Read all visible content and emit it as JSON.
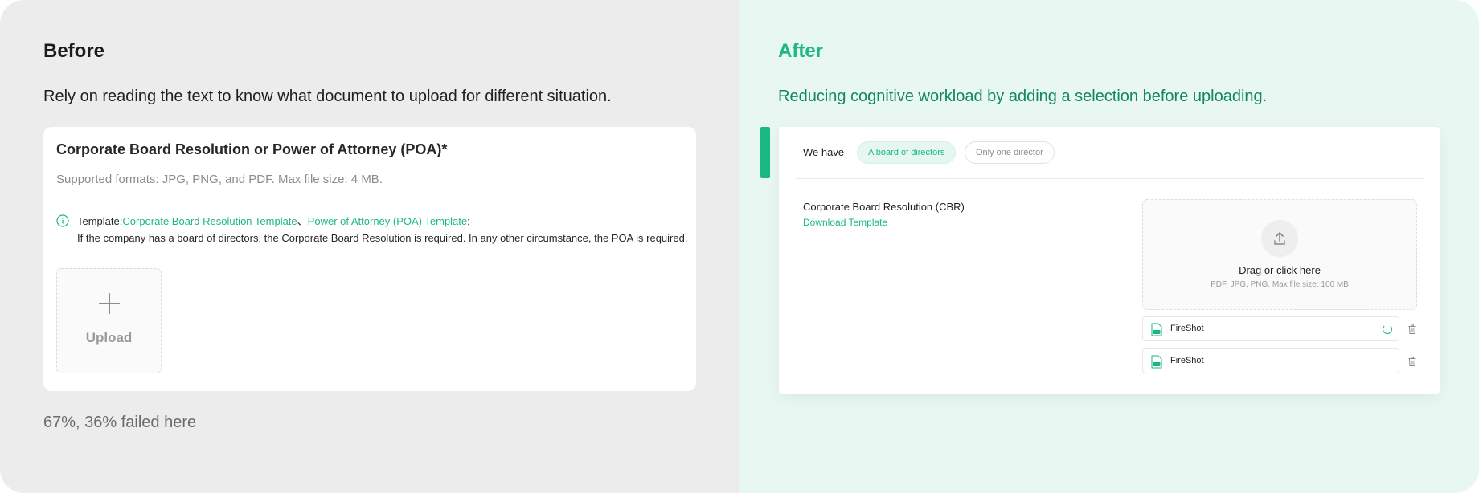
{
  "before": {
    "heading": "Before",
    "description": "Rely on reading the text to know what document to upload for different situation.",
    "card": {
      "title": "Corporate Board Resolution or Power of Attorney (POA)*",
      "formats": "Supported formats: JPG, PNG, and PDF. Max file size: 4 MB.",
      "template_prefix": "Template:",
      "template_link_1": "Corporate Board Resolution Template",
      "template_separator": "、",
      "template_link_2": "Power of Attorney (POA) Template",
      "template_suffix": ";",
      "rule": "If the company has a board of directors, the Corporate Board Resolution is required. In any other circumstance, the POA is required.",
      "upload_label": "Upload"
    },
    "stat": "67%, 36% failed here"
  },
  "after": {
    "heading": "After",
    "description": "Reducing cognitive workload by adding a selection before uploading.",
    "card": {
      "we_have": "We have",
      "option_selected": "A board of directors",
      "option_other": "Only one director",
      "doc_title": "Corporate Board Resolution (CBR)",
      "download_link": "Download Template",
      "dropzone_title": "Drag or click here",
      "dropzone_sub": "PDF, JPG, PNG. Max file size: 100 MB",
      "files": [
        "FireShot",
        "FireShot"
      ]
    }
  },
  "colors": {
    "accent": "#1bb882",
    "accent_dark": "#11885f",
    "left_bg": "#ececec",
    "right_bg": "#e9f7f3"
  },
  "icons": {
    "info": "info-icon",
    "plus": "plus-icon",
    "upload": "upload-arrow-icon",
    "file": "file-icon",
    "spinner": "loading-spinner-icon",
    "trash": "trash-icon"
  }
}
